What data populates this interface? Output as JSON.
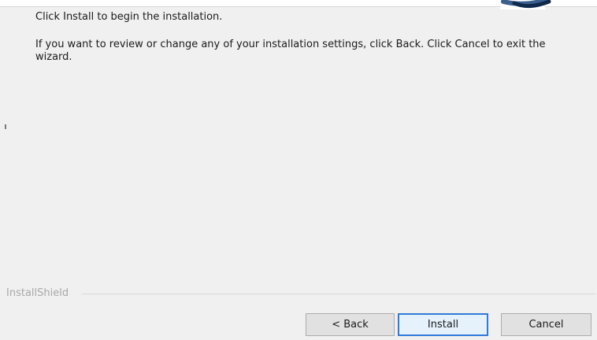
{
  "body": {
    "line1": "Click Install to begin the installation.",
    "line2": "If you want to review or change any of your installation settings, click Back. Click Cancel to exit the wizard."
  },
  "footer": {
    "brand": "InstallShield"
  },
  "buttons": {
    "back": "< Back",
    "install": "Install",
    "cancel": "Cancel"
  },
  "colors": {
    "dialog_bg": "#f0f0f0",
    "button_bg": "#e1e1e1",
    "primary_border": "#2f7bd9"
  },
  "icons": {
    "header_logo": "installer-logo-icon"
  }
}
